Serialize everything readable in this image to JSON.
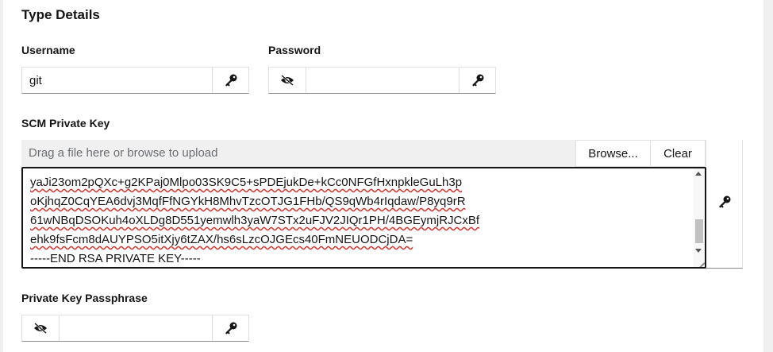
{
  "section_title": "Type Details",
  "username": {
    "label": "Username",
    "value": "git",
    "icon": "key-icon"
  },
  "password": {
    "label": "Password",
    "value": "",
    "toggle_icon": "eye-slash-icon",
    "icon": "key-icon"
  },
  "scm_private_key": {
    "label": "SCM Private Key",
    "upload_placeholder": "Drag a file here or browse to upload",
    "browse_label": "Browse...",
    "clear_label": "Clear",
    "lines": [
      "yaJi23om2pQXc+g2KPaj0Mlpo03SK9C5+sPDEjukDe+kCc0NFGfHxnpkleGuLh3p",
      "oKjhqZ0CqYEA6dvj3MqfFfNGYkH8MhvTzcOTJG1FHb/QS9qWb4rIqdaw/P8yq9rR",
      "61wNBqDSOKuh4oXLDg8D551yemwlh3yaW7STx2uFJV2JIQr1PH/4BGEymjRJCxBf",
      "ehk9fsFcm8dAUYPSO5itXjy6tZAX/hs6sLzcOJGEcs40FmNEUODCjDA=",
      "-----END RSA PRIVATE KEY-----"
    ],
    "icon": "key-icon"
  },
  "passphrase": {
    "label": "Private Key Passphrase",
    "value": "",
    "toggle_icon": "eye-slash-icon",
    "icon": "key-icon"
  }
}
